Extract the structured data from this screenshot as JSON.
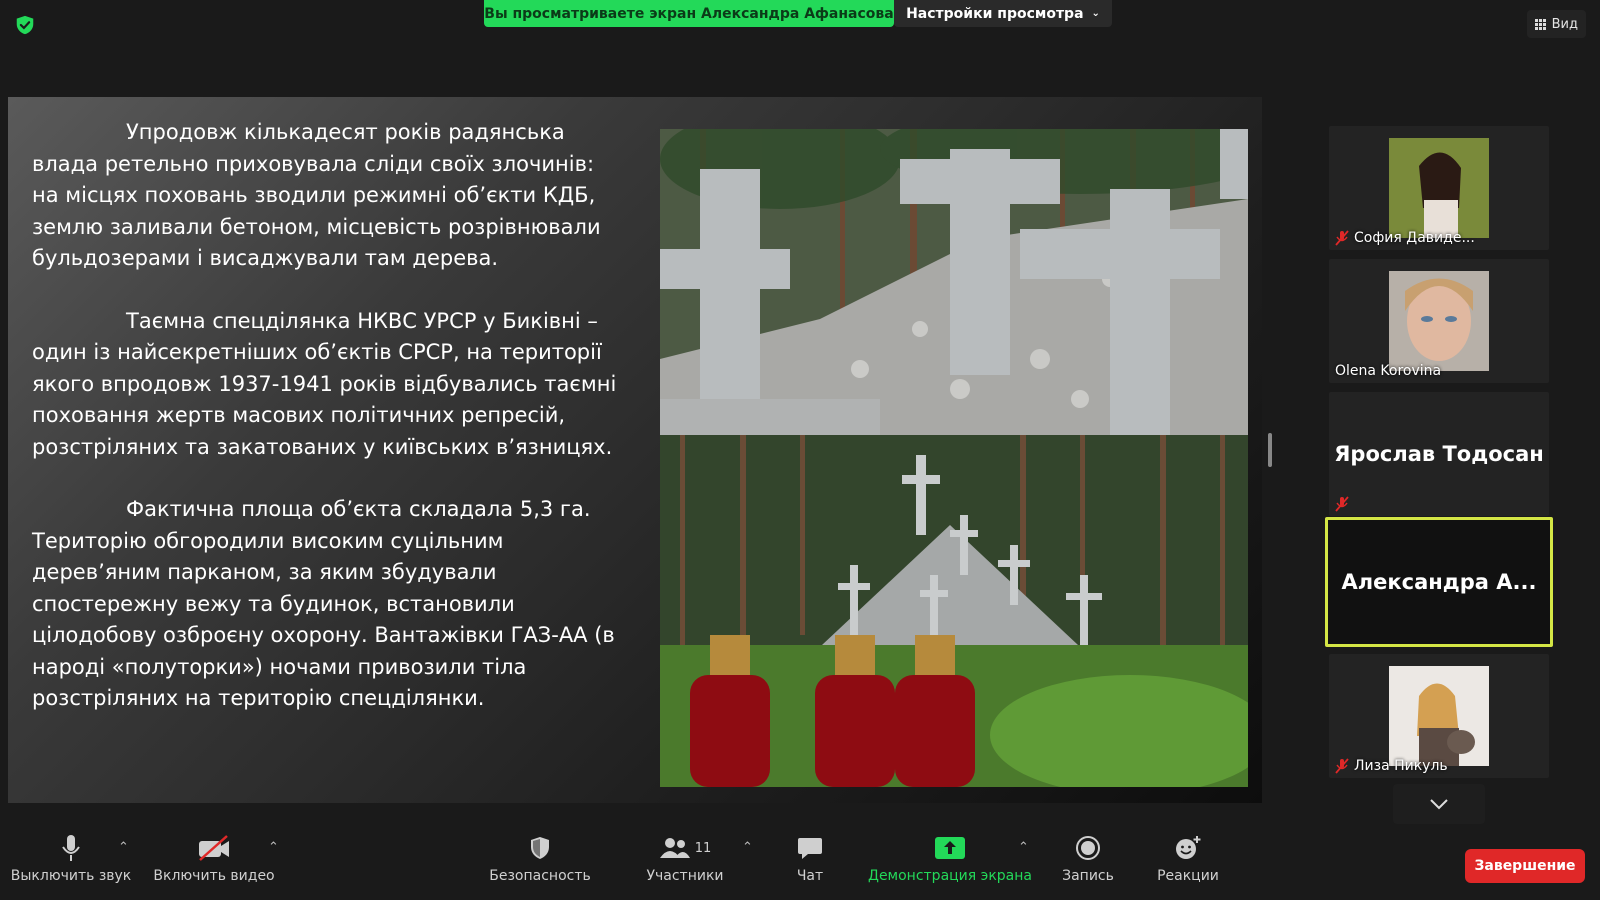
{
  "top": {
    "share_banner": "Вы просматриваете экран Александра Афанасова",
    "view_settings": "Настройки просмотра",
    "view_button": "Вид"
  },
  "slide": {
    "paragraphs": [
      "Упродовж кількадесят років радянська влада ретельно приховувала сліди своїх злочинів: на місцях поховань зводили режимні об’єкти КДБ, землю заливали бетоном, місцевість розрівнювали бульдозерами і висаджували там дерева.",
      "Таємна спецділянка НКВС УРСР у Биківні – один із найсекретніших об’єктів СРСР, на території якого впродовж 1937-1941 років відбувались таємні поховання жертв масових політичних репресій, розстріляних та закатованих у київських в’язницях.",
      "Фактична площа об’єкта складала 5,3 га. Територію обгородили високим суцільним дерев’яним парканом, за яким збудували спостережну вежу та будинок, встановили цілодобову озброєну охорону. Вантажівки ГАЗ-АА (в народі «полуторки») ночами привозили тіла розстріляних на територію спецділянки."
    ]
  },
  "participants": [
    {
      "name": "София Давиде...",
      "muted": true,
      "has_photo": true
    },
    {
      "name": "Olena Korovina",
      "muted": false,
      "has_photo": true
    },
    {
      "name": "Ярослав Тодосан",
      "muted": true,
      "has_photo": false
    },
    {
      "name": "Александра  А...",
      "muted": false,
      "has_photo": false,
      "active": true
    },
    {
      "name": "Лиза Пикуль",
      "muted": true,
      "has_photo": true
    }
  ],
  "toolbar": {
    "mute": "Выключить звук",
    "video": "Включить видео",
    "security": "Безопасность",
    "participants": "Участники",
    "participants_count": "11",
    "chat": "Чат",
    "share": "Демонстрация экрана",
    "record": "Запись",
    "reactions": "Реакции",
    "end": "Завершение"
  },
  "colors": {
    "share_green": "#23d959",
    "active_border": "#d4e645",
    "end_red": "#e02828"
  }
}
